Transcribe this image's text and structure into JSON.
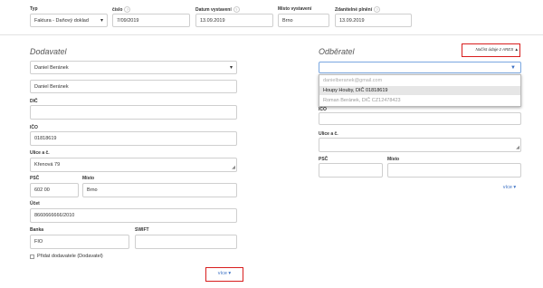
{
  "header": {
    "typ_label": "Typ",
    "typ_value": "Faktura - Daňový doklad",
    "cislo_label": "číslo",
    "cislo_value": "7/09/2019",
    "datum_label": "Datum vystavení",
    "datum_value": "13.09.2019",
    "misto_label": "Místo vystavení",
    "misto_value": "Brno",
    "zdanitelne_label": "Zdanitelné plnění",
    "zdanitelne_value": "13.09.2019"
  },
  "dodavatel": {
    "title": "Dodavatel",
    "select_value": "Daniel Beránek",
    "name_value": "Daniel Beránek",
    "dic_label": "DIČ",
    "dic_value": "",
    "ico_label": "IČO",
    "ico_value": "01818619",
    "ulice_label": "Ulice a č.",
    "ulice_value": "Křenová 79",
    "psc_label": "PSČ",
    "psc_value": "602 00",
    "misto_label": "Místo",
    "misto_value": "Brno",
    "ucet_label": "Účet",
    "ucet_value": "8660666666/2010",
    "banka_label": "Banka",
    "banka_value": "FIO",
    "swift_label": "SWIFT",
    "swift_value": "",
    "pridat_label": "Přidat dodavatele (Dodavatel)",
    "vice_label": "více ▾"
  },
  "odberatel": {
    "title": "Odběratel",
    "ares_button": "Načíst údaje z ARES ▲",
    "search_value": "",
    "suggestions": [
      "danielberanek@gmail.com",
      "Houpy Houby, DIČ 01818619",
      "Roman Beránek, DIČ CZ12478423"
    ],
    "ico_label": "IČO",
    "ulice_label": "Ulice a č.",
    "psc_label": "PSČ",
    "misto_label": "Místo",
    "vice_label": "více ▾"
  }
}
